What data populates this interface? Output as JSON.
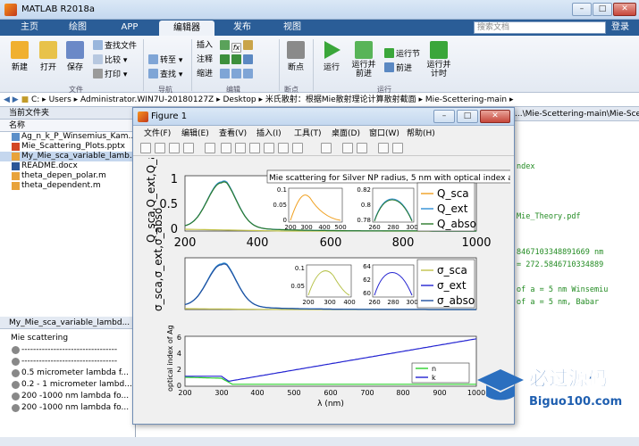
{
  "app": {
    "title": "MATLAB R2018a"
  },
  "tabs": [
    {
      "label": "主页"
    },
    {
      "label": "绘图"
    },
    {
      "label": "APP"
    },
    {
      "label": "编辑器"
    },
    {
      "label": "发布"
    },
    {
      "label": "视图"
    }
  ],
  "search": {
    "placeholder": "搜索文档"
  },
  "login": "登录",
  "ribbon": {
    "new": "新建",
    "open": "打开",
    "save": "保存",
    "find_files": "查找文件",
    "compare": "比较",
    "print": "打印",
    "goto": "转至",
    "find": "查找",
    "insert": "插入",
    "comment": "注释",
    "indent": "缩进",
    "fx": "fx",
    "breakpoint": "断点",
    "run": "运行",
    "run_advance": "运行并\n前进",
    "run_section": "运行节",
    "advance": "前进",
    "run_time": "运行并\n计时",
    "groups": {
      "file": "文件",
      "nav": "导航",
      "edit": "编辑",
      "bp": "断点",
      "run": "运行"
    }
  },
  "address": {
    "parts": [
      "C:",
      "Users",
      "Administrator.WIN7U-20180127Z",
      "Desktop",
      "米氏散射：根据Mie散射理论计算散射截面",
      "Mie-Scettering-main"
    ]
  },
  "current_folder": {
    "title": "当前文件夹",
    "col": "名称",
    "files": [
      "Ag_n_k_P_Winsemius_Kam...",
      "Mie_Scattering_Plots.pptx",
      "My_Mie_sca_variable_lamb...",
      "README.docx",
      "theta_depen_polar.m",
      "theta_dependent.m"
    ]
  },
  "details": {
    "title": "My_Mie_sca_variable_lambd...",
    "name": "Mie scattering",
    "items": [
      "---------------------------------",
      "---------------------------------",
      "0.5 micrometer lambda f...",
      "0.2 - 1 micrometer lambd...",
      "200 -1000 nm lambda fo...",
      "200 -1000 nm lambda fo..."
    ]
  },
  "editor": {
    "tab": "...\\Mie-Scettering-main\\Mie-Scett...",
    "lines": [
      "ndex",
      "Mie_Theory.pdf",
      "8467103348891669 nm",
      "= 272.5846710334889",
      "of a = 5 nm Winsemiu",
      "of a = 5 nm, Babar"
    ]
  },
  "figure": {
    "title": "Figure 1",
    "menu": [
      "文件(F)",
      "编辑(E)",
      "查看(V)",
      "插入(I)",
      "工具(T)",
      "桌面(D)",
      "窗口(W)",
      "帮助(H)"
    ],
    "plot_title": "Mie scattering for Silver NP radius, 5 nm with optical index as",
    "ax1": {
      "ylabel": "Q_sca,Q_ext,Q_abso",
      "yticks": [
        "0",
        "0.5",
        "1"
      ],
      "xticks": [
        "200",
        "400",
        "600",
        "800",
        "1000"
      ],
      "legend": [
        "Q_sca",
        "Q_ext",
        "Q_abso"
      ],
      "inset1": {
        "yticks": [
          "0.1",
          "0.05",
          "0"
        ],
        "xticks": [
          "200",
          "300",
          "400",
          "500"
        ]
      },
      "inset2": {
        "yticks": [
          "0.82",
          "0.8",
          "0.78"
        ],
        "xticks": [
          "260",
          "280",
          "300"
        ]
      }
    },
    "ax2": {
      "ylabel": "σ_sca,σ_ext,σ_abso",
      "xticks": [
        "200",
        "400",
        "600",
        "800",
        "1000"
      ],
      "legend": [
        "σ_sca",
        "σ_ext",
        "σ_abso"
      ],
      "inset1": {
        "yticks": [
          "0.1",
          "0.05"
        ],
        "xticks": [
          "200",
          "300",
          "400"
        ]
      },
      "inset2": {
        "yticks": [
          "64",
          "62",
          "60"
        ],
        "xticks": [
          "260",
          "280",
          "300"
        ]
      }
    },
    "ax3": {
      "ylabel": "optical index of Ag",
      "xlabel": "λ (nm)",
      "yticks": [
        "0",
        "2",
        "4",
        "6"
      ],
      "xticks": [
        "200",
        "300",
        "400",
        "500",
        "600",
        "700",
        "800",
        "900",
        "1000"
      ],
      "legend": [
        "n",
        "k"
      ]
    }
  },
  "watermark": {
    "cn": "必过源码",
    "url": "Biguo100.com"
  },
  "colors": {
    "sca": "#c2c24a",
    "ext": "#2e8fd6",
    "abso": "#2b7a2b",
    "n": "#2bd12b",
    "k": "#2323d1",
    "ribbon_tab": "#2a5d97"
  }
}
